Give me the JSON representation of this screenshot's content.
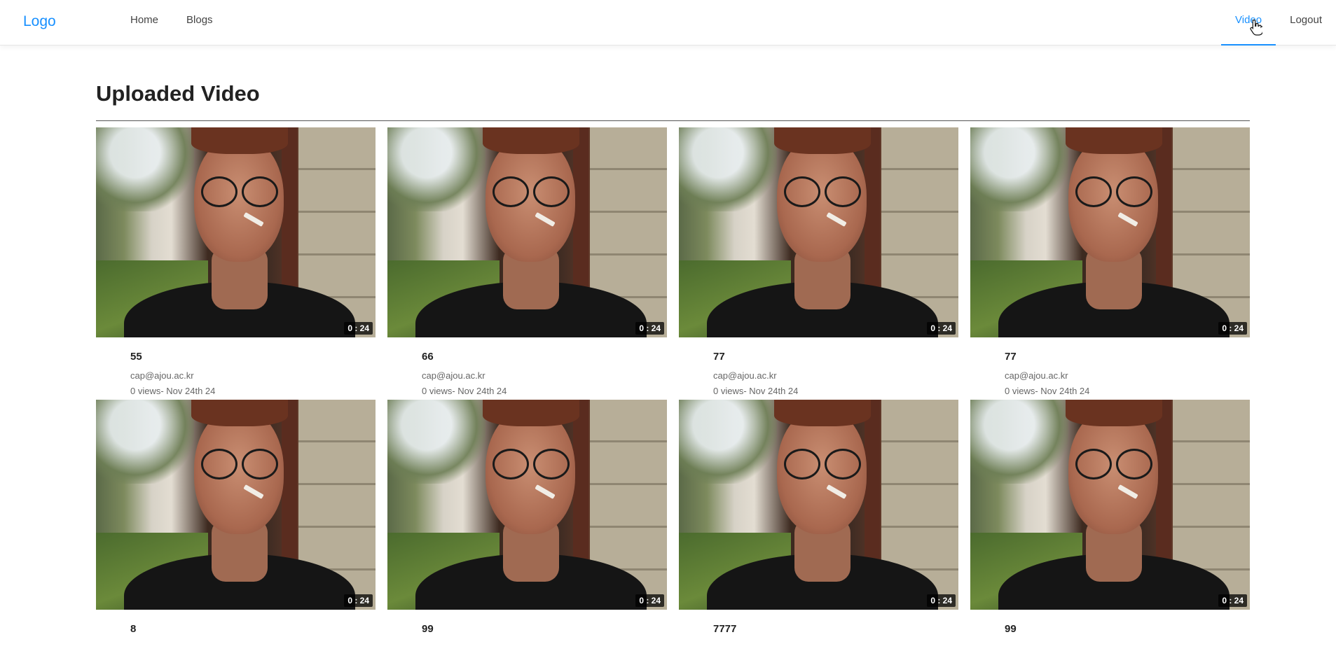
{
  "header": {
    "logo": "Logo",
    "nav_left": [
      "Home",
      "Blogs"
    ],
    "nav_right": [
      {
        "label": "Video",
        "active": true
      },
      {
        "label": "Logout",
        "active": false
      }
    ],
    "accent_color": "#1890ff"
  },
  "main": {
    "title": "Uploaded Video"
  },
  "videos": [
    {
      "title": "55",
      "writer": "cap@ajou.ac.kr",
      "views_date": "0 views- Nov 24th 24",
      "duration": "0 : 24"
    },
    {
      "title": "66",
      "writer": "cap@ajou.ac.kr",
      "views_date": "0 views- Nov 24th 24",
      "duration": "0 : 24"
    },
    {
      "title": "77",
      "writer": "cap@ajou.ac.kr",
      "views_date": "0 views- Nov 24th 24",
      "duration": "0 : 24"
    },
    {
      "title": "77",
      "writer": "cap@ajou.ac.kr",
      "views_date": "0 views- Nov 24th 24",
      "duration": "0 : 24"
    },
    {
      "title": "8",
      "writer": "",
      "views_date": "",
      "duration": "0 : 24"
    },
    {
      "title": "99",
      "writer": "",
      "views_date": "",
      "duration": "0 : 24"
    },
    {
      "title": "7777",
      "writer": "",
      "views_date": "",
      "duration": "0 : 24"
    },
    {
      "title": "99",
      "writer": "",
      "views_date": "",
      "duration": "0 : 24"
    }
  ]
}
